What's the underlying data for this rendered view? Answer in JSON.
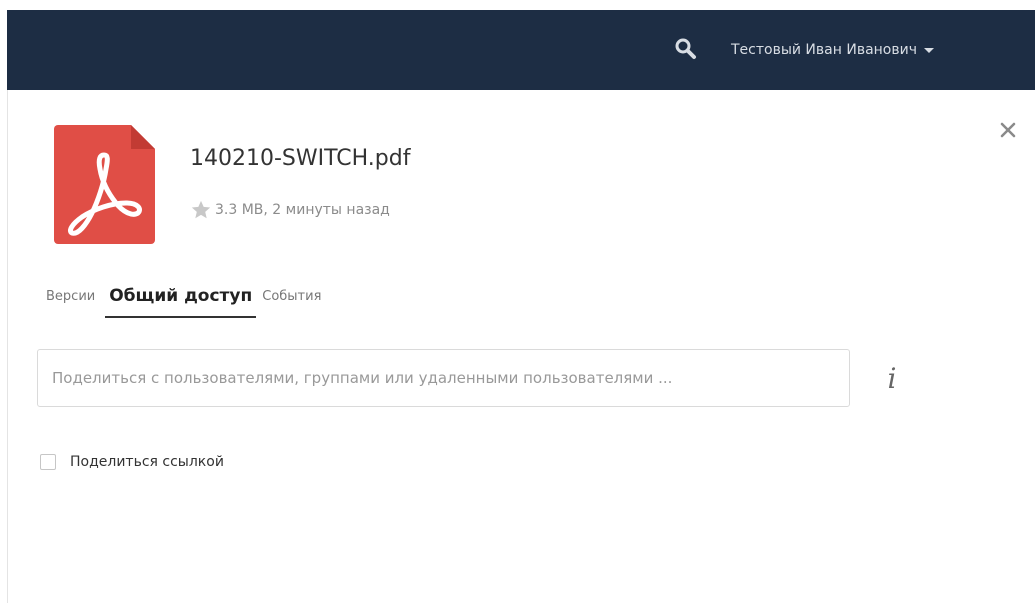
{
  "header": {
    "user_name": "Тестовый Иван Иванович",
    "background_color": "#1d2d44",
    "icons": [
      "search-icon",
      "caret-down-icon"
    ]
  },
  "file": {
    "name": "140210-SWITCH.pdf",
    "meta": "3.3 MB, 2 минуты назад",
    "icon": "pdf-file-icon",
    "icon_color": "#e04e46",
    "favorite_icon": "star-icon"
  },
  "tabs": [
    {
      "label": "Версии",
      "active": false
    },
    {
      "label": "Общий доступ",
      "active": true
    },
    {
      "label": "События",
      "active": false
    }
  ],
  "share": {
    "placeholder": "Поделиться с пользователями, группами или удаленными пользователями ...",
    "info_label": "i"
  },
  "link_share": {
    "label": "Поделиться ссылкой",
    "checked": false
  },
  "close_icon": "close-icon"
}
